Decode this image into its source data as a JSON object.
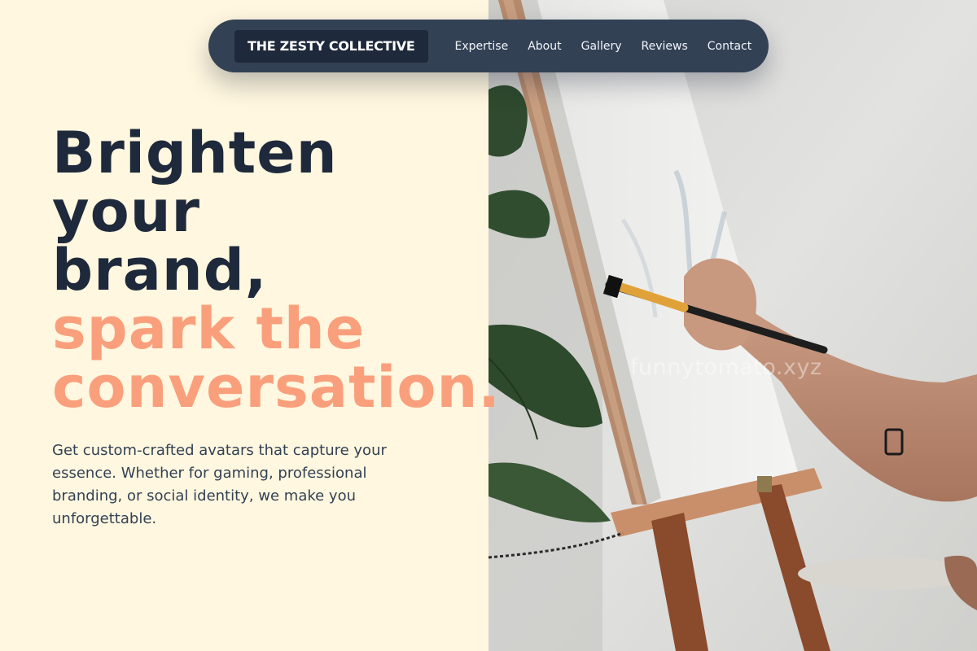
{
  "nav": {
    "brand": "THE ZESTY COLLECTIVE",
    "links": [
      "Expertise",
      "About",
      "Gallery",
      "Reviews",
      "Contact"
    ]
  },
  "hero": {
    "headline_lines": [
      "Brighten",
      "your",
      "brand,"
    ],
    "accent_lines": [
      "spark the",
      "conversation."
    ],
    "subtext": "Get custom-crafted avatars that capture your essence. Whether for gaming, professional branding, or social identity, we make you unforgettable."
  },
  "watermark": "funnytomato.xyz",
  "colors": {
    "background": "#fff7df",
    "nav": "#334155",
    "brand_box": "#1e293b",
    "heading": "#1e293b",
    "accent": "#fa9f7c"
  }
}
